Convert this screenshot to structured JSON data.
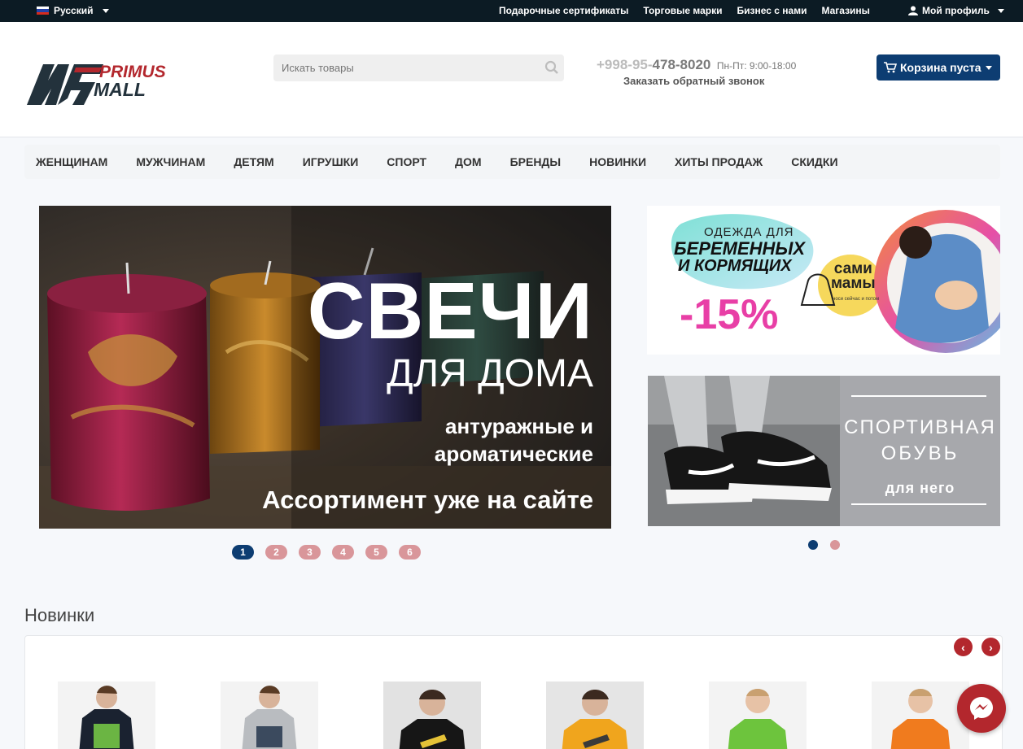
{
  "topbar": {
    "language": "Русский",
    "links": [
      "Подарочные сертификаты",
      "Торговые марки",
      "Бизнес с нами",
      "Магазины"
    ],
    "profile": "Мой профиль"
  },
  "header": {
    "logo_text_1": "PRIMUS",
    "logo_text_2": "MALL",
    "search_placeholder": "Искать товары",
    "phone_prefix": "+998-95-",
    "phone_main": "478-8020",
    "hours": "Пн-Пт: 9:00-18:00",
    "callback": "Заказать обратный звонок",
    "cart": "Корзина пуста"
  },
  "nav": [
    "ЖЕНЩИНАМ",
    "МУЖЧИНАМ",
    "ДЕТЯМ",
    "ИГРУШКИ",
    "СПОРТ",
    "ДОМ",
    "БРЕНДЫ",
    "НОВИНКИ",
    "ХИТЫ ПРОДАЖ",
    "СКИДКИ"
  ],
  "main_slider": {
    "title": "СВЕЧИ",
    "subtitle": "ДЛЯ ДОМА",
    "line1": "антуражные и",
    "line2": "ароматические",
    "line3": "Ассортимент уже на сайте",
    "pages": [
      "1",
      "2",
      "3",
      "4",
      "5",
      "6"
    ],
    "active_page": "1"
  },
  "promo1": {
    "line1": "ОДЕЖДА ДЛЯ",
    "line2": "БЕРЕМЕННЫХ",
    "line3": "И КОРМЯЩИХ",
    "discount": "-15%",
    "brand1": "сами",
    "brand2": "мамы",
    "brand_tag": "носи сейчас и потом"
  },
  "promo2": {
    "line1": "СПОРТИВНАЯ",
    "line2": "ОБУВЬ",
    "line3": "для него"
  },
  "section": {
    "title": "Новинки"
  },
  "colors": {
    "accent_navy": "#0d3d72",
    "accent_red": "#b3272d",
    "topbar": "#0c1b24"
  }
}
